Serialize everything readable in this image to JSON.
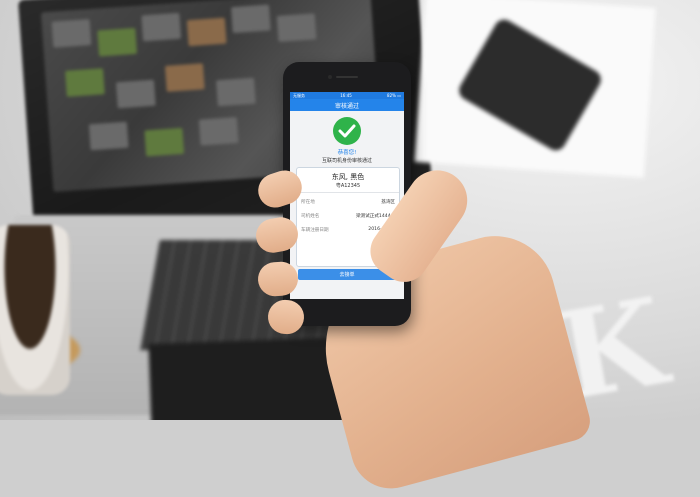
{
  "phone": {
    "status_bar": {
      "carrier": "无服务",
      "time": "16:45",
      "battery": "82%"
    },
    "title": "审核通过",
    "success_title": "恭喜您!",
    "success_message": "互联司机身份审核通过",
    "card": {
      "car_model": "东风, 黑色",
      "plate": "粤A12345",
      "rows": [
        {
          "label": "所在地",
          "value": "荔湾区"
        },
        {
          "label": "司机姓名",
          "value": "梁测试正式1444..."
        },
        {
          "label": "车辆注册日期",
          "value": "2016-06-17"
        }
      ]
    },
    "button_label": "去接单",
    "colors": {
      "accent": "#2484ea",
      "success": "#2fb34a"
    }
  },
  "icons": [
    "checkmark-icon",
    "battery-icon"
  ]
}
